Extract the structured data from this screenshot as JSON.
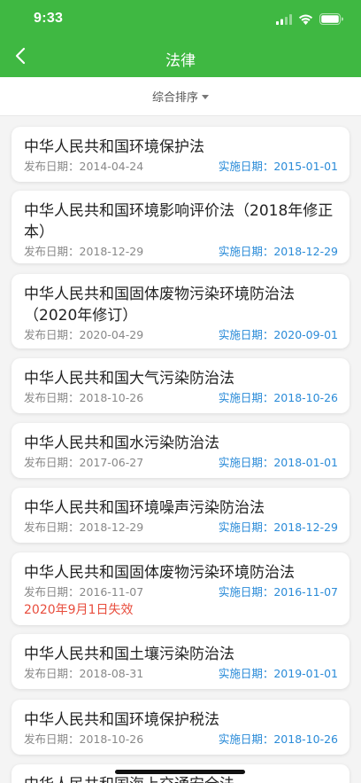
{
  "status_bar": {
    "time": "9:33"
  },
  "nav": {
    "title": "法律",
    "back_icon": "chevron-left-icon"
  },
  "sort": {
    "label": "综合排序"
  },
  "colors": {
    "header_green": "#3fb842",
    "effective_blue": "#2a8bd8",
    "invalid_red": "#e84d3d"
  },
  "laws": [
    {
      "title": "中华人民共和国环境保护法",
      "published": "发布日期：2014-04-24",
      "effective": "实施日期：2015-01-01"
    },
    {
      "title": "中华人民共和国环境影响评价法（2018年修正本）",
      "published": "发布日期：2018-12-29",
      "effective": "实施日期：2018-12-29"
    },
    {
      "title": "中华人民共和国固体废物污染环境防治法（2020年修订）",
      "published": "发布日期：2020-04-29",
      "effective": "实施日期：2020-09-01"
    },
    {
      "title": "中华人民共和国大气污染防治法",
      "published": "发布日期：2018-10-26",
      "effective": "实施日期：2018-10-26"
    },
    {
      "title": "中华人民共和国水污染防治法",
      "published": "发布日期：2017-06-27",
      "effective": "实施日期：2018-01-01"
    },
    {
      "title": "中华人民共和国环境噪声污染防治法",
      "published": "发布日期：2018-12-29",
      "effective": "实施日期：2018-12-29"
    },
    {
      "title": "中华人民共和国固体废物污染环境防治法",
      "published": "发布日期：2016-11-07",
      "effective": "实施日期：2016-11-07",
      "note": "2020年9月1日失效"
    },
    {
      "title": "中华人民共和国土壤污染防治法",
      "published": "发布日期：2018-08-31",
      "effective": "实施日期：2019-01-01"
    },
    {
      "title": "中华人民共和国环境保护税法",
      "published": "发布日期：2018-10-26",
      "effective": "实施日期：2018-10-26"
    },
    {
      "title": "中华人民共和国海上交通安全法"
    }
  ]
}
